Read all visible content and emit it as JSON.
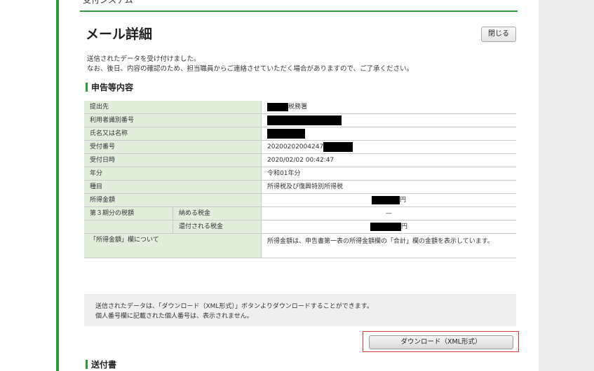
{
  "header": {
    "system_name": "受付システム"
  },
  "page": {
    "title": "メール詳細",
    "close_label": "閉じる"
  },
  "message": {
    "line1": "送信されたデータを受け付けました。",
    "line2": "なお、後日、内容の確認のため、担当職員からご連絡させていただく場合がありますので、ご了承ください。"
  },
  "section1": {
    "title": "申告等内容"
  },
  "table": {
    "submit_to": {
      "label": "提出先",
      "suffix": "税務署"
    },
    "user_id": {
      "label": "利用者識別番号"
    },
    "name": {
      "label": "氏名又は名称"
    },
    "receipt_no": {
      "label": "受付番号",
      "value": "20200202004247"
    },
    "receipt_time": {
      "label": "受付日時",
      "value": "2020/02/02 00:42:47"
    },
    "year": {
      "label": "年分",
      "value": "令和01年分"
    },
    "category": {
      "label": "種目",
      "value": "所得税及び復興特別所得税"
    },
    "income": {
      "label": "所得金額",
      "suffix": "円"
    },
    "tax_group": {
      "label": "第３期分の税額"
    },
    "tax_pay": {
      "label": "納める税金",
      "value": "—"
    },
    "tax_refund": {
      "label": "還付される税金",
      "suffix": "円"
    },
    "note": {
      "label": "「所得金額」欄について",
      "value": "所得金額は、申告書第一表の所得金額欄の「合計」欄の金額を表示しています。"
    }
  },
  "info": {
    "line1": "送信されたデータは、「ダウンロード（XML形式）」ボタンよりダウンロードすることができます。",
    "line2": "個人番号欄に記載された個人番号は、表示されません。"
  },
  "download": {
    "label": "ダウンロード（XML形式）"
  },
  "section2": {
    "title": "送付書"
  },
  "colors": {
    "accent_green": "#2e9a3a",
    "label_bg": "#e1eedb",
    "highlight_red": "#d83a3a"
  }
}
